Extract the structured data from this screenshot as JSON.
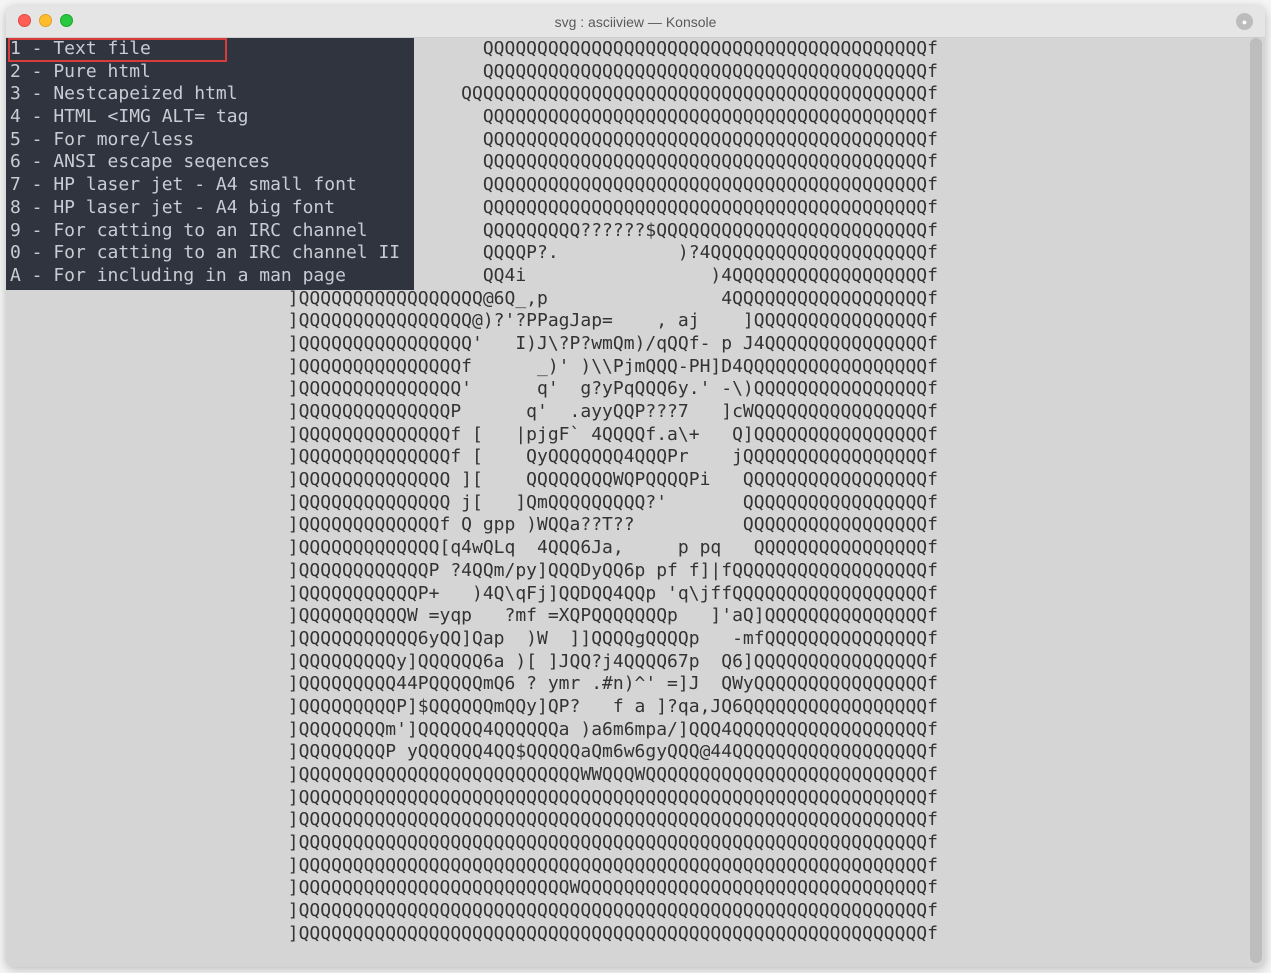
{
  "window": {
    "title": "svg : asciiview — Konsole"
  },
  "menu": {
    "items": [
      {
        "key": "1",
        "label": "Text file",
        "selected": true
      },
      {
        "key": "2",
        "label": "Pure html",
        "selected": false
      },
      {
        "key": "3",
        "label": "Nestcapeized html",
        "selected": false
      },
      {
        "key": "4",
        "label": "HTML <IMG ALT= tag",
        "selected": false
      },
      {
        "key": "5",
        "label": "For more/less",
        "selected": false
      },
      {
        "key": "6",
        "label": "ANSI escape seqences",
        "selected": false
      },
      {
        "key": "7",
        "label": "HP laser jet - A4 small font",
        "selected": false
      },
      {
        "key": "8",
        "label": "HP laser jet - A4 big font",
        "selected": false
      },
      {
        "key": "9",
        "label": "For catting to an IRC channel",
        "selected": false
      },
      {
        "key": "0",
        "label": "For catting to an IRC channel II",
        "selected": false
      },
      {
        "key": "A",
        "label": "For including in a man page",
        "selected": false
      }
    ]
  },
  "ascii": {
    "rows": [
      "                                            QQQQQQQQQQQQQQQQQQQQQQQQQQQQQQQQQQQQQQQQQf",
      "                                            QQQQQQQQQQQQQQQQQQQQQQQQQQQQQQQQQQQQQQQQQf",
      "                                          QQQQQQQQQQQQQQQQQQQQQQQQQQQQQQQQQQQQQQQQQQQf",
      "                                            QQQQQQQQQQQQQQQQQQQQQQQQQQQQQQQQQQQQQQQQQf",
      "                                            QQQQQQQQQQQQQQQQQQQQQQQQQQQQQQQQQQQQQQQQQf",
      "                                            QQQQQQQQQQQQQQQQQQQQQQQQQQQQQQQQQQQQQQQQQf",
      "                                            QQQQQQQQQQQQQQQQQQQQQQQQQQQQQQQQQQQQQQQQQf",
      "                                            QQQQQQQQQQQQQQQQQQQQQQQQQQQQQQQQQQQQQQQQQf",
      "                                            QQQQQQQQQ??????$QQQQQQQQQQQQQQQQQQQQQQQQQf",
      "                                            QQQQP?.           )?4QQQQQQQQQQQQQQQQQQQQf",
      "                                            QQ4i                 )4QQQQQQQQQQQQQQQQQQf",
      "                          ]QQQQQQQQQQQQQQQQQ@6Q_,p                4QQQQQQQQQQQQQQQQQQf",
      "                          ]QQQQQQQQQQQQQQQQ@)?'?PPagJap=    , aj    ]QQQQQQQQQQQQQQQQf",
      "                          ]QQQQQQQQQQQQQQQQ'   I)J\\?P?wmQm)/qQQf- p J4QQQQQQQQQQQQQQQf",
      "                          ]QQQQQQQQQQQQQQQf      _)' )\\\\PjmQQQ-PH]D4QQQQQQQQQQQQQQQQQf",
      "                          ]QQQQQQQQQQQQQQQ'      q'  g?yPqQQQ6y.' -\\)QQQQQQQQQQQQQQQQf",
      "                          ]QQQQQQQQQQQQQQP      q'  .ayyQQP???7   ]cWQQQQQQQQQQQQQQQQf",
      "                          ]QQQQQQQQQQQQQQf [   |pjgF` 4QQQQf.a\\+   Q]QQQQQQQQQQQQQQQQf",
      "                          ]QQQQQQQQQQQQQQf [    QyQQQQQQQ4QQQPr    jQQQQQQQQQQQQQQQQQf",
      "                          ]QQQQQQQQQQQQQQ ][    QQQQQQQQWQPQQQQPi   QQQQQQQQQQQQQQQQQf",
      "                          ]QQQQQQQQQQQQQQ j[   ]QmQQQQQQQQQ?'       QQQQQQQQQQQQQQQQQf",
      "                          ]QQQQQQQQQQQQQf Q gpp )WQQa??T??          QQQQQQQQQQQQQQQQQf",
      "                          ]QQQQQQQQQQQQQ[q4wQLq  4QQQ6Ja,     p pq   QQQQQQQQQQQQQQQQf",
      "                          ]QQQQQQQQQQQQP ?4QQm/py]QQQDyQQ6p pf f]|fQQQQQQQQQQQQQQQQQQf",
      "                          ]QQQQQQQQQQQP+   )4Q\\qFj]QQDQQ4QQp 'q\\jffQQQQQQQQQQQQQQQQQQf",
      "                          ]QQQQQQQQQQW =yqp   ?mf =XQPQQQQQQQp   ]'aQ]QQQQQQQQQQQQQQQf",
      "                          ]QQQQQQQQQQQ6yQQ]Qap  )W  ]]QQQQgQQQQp   -mfQQQQQQQQQQQQQQQf",
      "                          ]QQQQQQQQQy]QQQQQQ6a )[ ]JQQ?j4QQQQ67p  Q6]QQQQQQQQQQQQQQQQf",
      "                          ]QQQQQQQQQ44PQQQQQmQ6 ? ymr .#n)^' =]J  QWyQQQQQQQQQQQQQQQQf",
      "                          ]QQQQQQQQQP]$QQQQQQmQQy]QP?   f a ]?qa,JQ6QQQQQQQQQQQQQQQQQf",
      "                          ]QQQQQQQQm']QQQQQQ4QQQQQQa )a6m6mpa/]QQQ4QQQQQQQQQQQQQQQQQQf",
      "                          ]QQQQQQQQP yQQQQQQ4QQ$QQQQQaQm6w6gyQQQ@44QQQQQQQQQQQQQQQQQQf",
      "                          ]QQQQQQQQQQQQQQQQQQQQQQQQQQWWQQQWQQQQQQQQQQQQQQQQQQQQQQQQQQf",
      "                          ]QQQQQQQQQQQQQQQQQQQQQQQQQQQQQQQQQQQQQQQQQQQQQQQQQQQQQQQQQQf",
      "                          ]QQQQQQQQQQQQQQQQQQQQQQQQQQQQQQQQQQQQQQQQQQQQQQQQQQQQQQQQQQf",
      "                          ]QQQQQQQQQQQQQQQQQQQQQQQQQQQQQQQQQQQQQQQQQQQQQQQQQQQQQQQQQQf",
      "                          ]QQQQQQQQQQQQQQQQQQQQQQQQQQQQQQQQQQQQQQQQQQQQQQQQQQQQQQQQQQf",
      "                          ]QQQQQQQQQQQQQQQQQQQQQQQQQWQQQQQQQQQQQQQQQQQQQQQQQQQQQQQQQQf",
      "                          ]QQQQQQQQQQQQQQQQQQQQQQQQQQQQQQQQQQQQQQQQQQQQQQQQQQQQQQQQQQf",
      "                          ]QQQQQQQQQQQQQQQQQQQQQQQQQQQQQQQQQQQQQQQQQQQQQQQQQQQQQQQQQQf"
    ]
  }
}
